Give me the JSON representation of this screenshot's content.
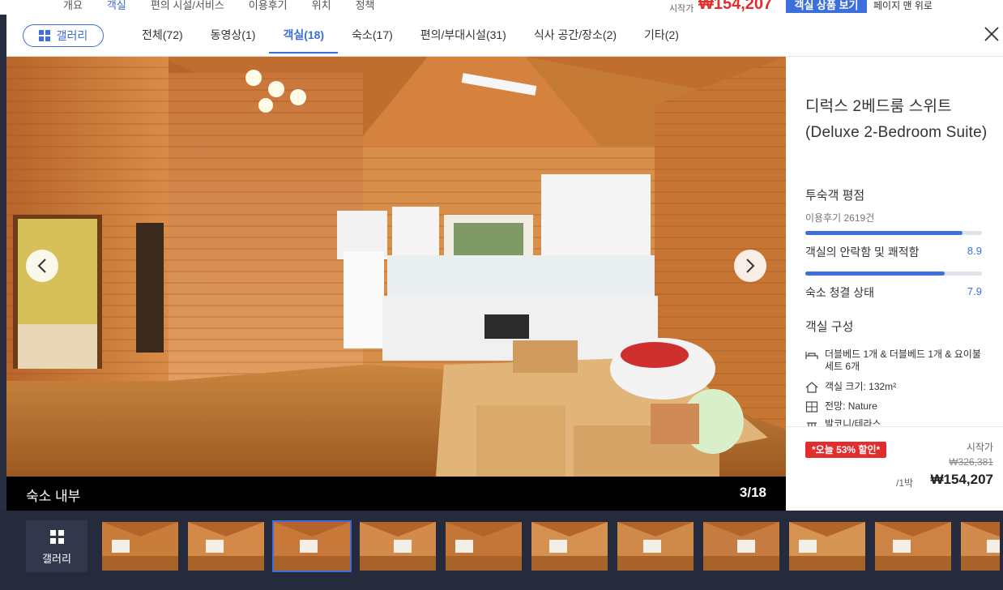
{
  "background_page": {
    "nav_items": [
      "개요",
      "객실",
      "편의 시설/서비스",
      "이용후기",
      "위치",
      "정책"
    ],
    "active_nav": 1,
    "price_label": "시작가",
    "price": "₩154,207",
    "room_button": "객실 상품 보기",
    "back_to_top": "페이지 맨 위로"
  },
  "modal": {
    "gallery_button": "갤러리",
    "tabs": [
      {
        "label": "전체(72)"
      },
      {
        "label": "동영상(1)"
      },
      {
        "label": "객실(18)"
      },
      {
        "label": "숙소(17)"
      },
      {
        "label": "편의/부대시설(31)"
      },
      {
        "label": "식사 공간/장소(2)"
      },
      {
        "label": "기타(2)"
      }
    ],
    "active_tab": 2,
    "caption": "숙소 내부",
    "photo_counter": "3/18"
  },
  "panel": {
    "room_name": "디럭스 2베드룸 스위트 (Deluxe 2-Bedroom Suite)",
    "rating_title": "투숙객 평점",
    "review_count": "이용후기 2619건",
    "ratings": [
      {
        "label": "객실의 안락함 및 쾌적함",
        "score": "8.9",
        "fraction": 0.89
      },
      {
        "label": "숙소 청결 상태",
        "score": "7.9",
        "fraction": 0.79
      }
    ],
    "composition_title": "객실 구성",
    "amenities": [
      {
        "icon": "bed-icon",
        "text": "더블베드 1개 & 더블베드 1개 & 요이불 세트 6개"
      },
      {
        "icon": "house-icon",
        "text": "객실 크기: 132m²"
      },
      {
        "icon": "view-icon",
        "text": "전망: Nature"
      },
      {
        "icon": "balcony-icon",
        "text": "발코니/테라스"
      }
    ]
  },
  "pricing": {
    "deal_badge": "*오늘 53% 할인*",
    "from_label": "시작가",
    "original_price": "₩326,381",
    "per_night": "/1박",
    "final_price": "₩154,207"
  },
  "filmstrip": {
    "gallery_label": "갤러리",
    "active_index": 2
  },
  "colors": {
    "accent": "#3d6fdc",
    "deal_red": "#e12d2d",
    "filmstrip_bg": "#262a3d",
    "wood": "#c57a35"
  }
}
